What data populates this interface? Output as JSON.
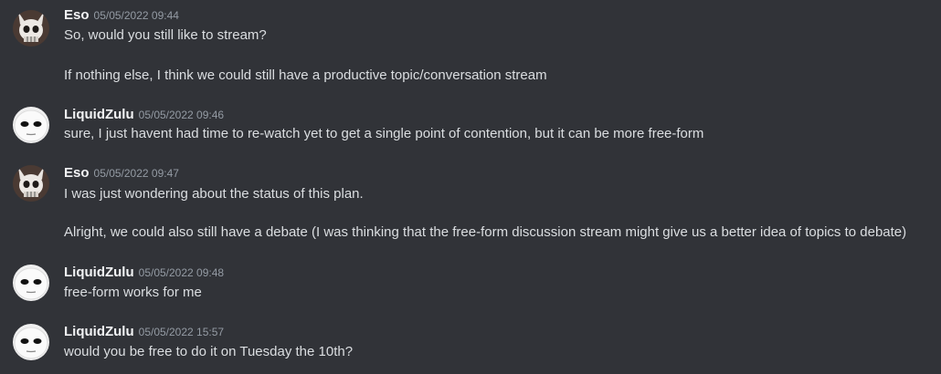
{
  "messages": [
    {
      "author": "Eso",
      "avatar_icon": "cat-skull-avatar-icon",
      "timestamp": "05/05/2022 09:44",
      "lines": [
        "So, would you still like to stream?",
        "If nothing else, I think we could still have a productive topic/conversation stream"
      ]
    },
    {
      "author": "LiquidZulu",
      "avatar_icon": "mask-face-avatar-icon",
      "timestamp": "05/05/2022 09:46",
      "lines": [
        "sure, I just havent had time to re-watch yet to get a single point of contention, but it can be more free-form"
      ]
    },
    {
      "author": "Eso",
      "avatar_icon": "cat-skull-avatar-icon",
      "timestamp": "05/05/2022 09:47",
      "lines": [
        "I was just wondering about the status of this plan.",
        "Alright, we could also still have a debate (I was thinking that the free-form discussion stream might give us a better idea of topics to debate)"
      ]
    },
    {
      "author": "LiquidZulu",
      "avatar_icon": "mask-face-avatar-icon",
      "timestamp": "05/05/2022 09:48",
      "lines": [
        "free-form works for me"
      ]
    },
    {
      "author": "LiquidZulu",
      "avatar_icon": "mask-face-avatar-icon",
      "timestamp": "05/05/2022 15:57",
      "lines": [
        "would you be free to do it on Tuesday the 10th?"
      ]
    }
  ],
  "colors": {
    "background": "#313338",
    "username": "#f2f3f5",
    "timestamp": "#949ba4",
    "text": "#dbdee1"
  }
}
